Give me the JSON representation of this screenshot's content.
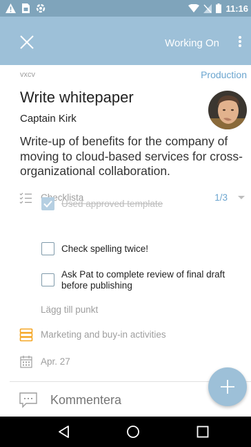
{
  "status_bar": {
    "time": "11:16"
  },
  "app_bar": {
    "title": "Working On"
  },
  "card": {
    "board": "vxcv",
    "list": "Production",
    "title": "Write whitepaper",
    "assignee": "Captain Kirk",
    "description": "Write-up of benefits for the company of moving to cloud-based services for cross-organizational collaboration."
  },
  "checklist": {
    "title": "Checklista",
    "progress": "1/3",
    "items": [
      {
        "label": "Used approved template",
        "done": true
      },
      {
        "label": "Check spelling twice!",
        "done": false
      },
      {
        "label": "Ask Pat to complete review of final draft before publishing",
        "done": false
      }
    ],
    "add_item": "Lägg till punkt"
  },
  "label": {
    "text": "Marketing and buy-in activities",
    "color": "#f5a623"
  },
  "due": {
    "text": "Apr. 27"
  },
  "comment": {
    "placeholder": "Kommentera"
  },
  "colors": {
    "app_bar": "#9dc0d8",
    "status_bar": "#7fa4bb",
    "accent": "#6aa5cf"
  },
  "icons": [
    "warning-icon",
    "sim-icon",
    "app-icon",
    "wifi-icon",
    "no-signal-icon",
    "battery-icon",
    "close-icon",
    "more-vert-icon",
    "checklist-icon",
    "label-icon",
    "calendar-icon",
    "comment-icon",
    "add-icon",
    "back-icon",
    "home-icon",
    "recents-icon"
  ]
}
